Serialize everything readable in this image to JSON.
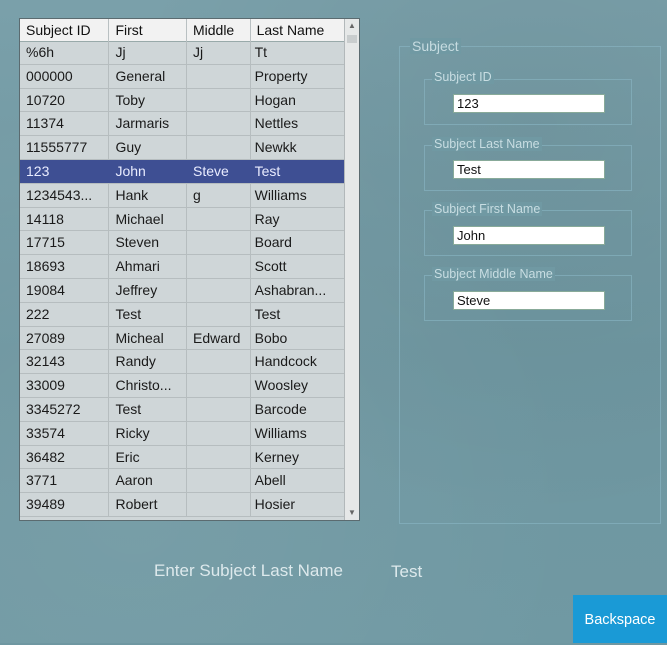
{
  "grid": {
    "columns": [
      "Subject ID",
      "First",
      "Middle",
      "Last Name"
    ],
    "rows": [
      [
        "%6h",
        "Jj",
        "Jj",
        "Tt"
      ],
      [
        "000000",
        "General",
        "",
        "Property"
      ],
      [
        "10720",
        "Toby",
        "",
        "Hogan"
      ],
      [
        "11374",
        "Jarmaris",
        "",
        "Nettles"
      ],
      [
        "11555777",
        "Guy",
        "",
        "Newkk"
      ],
      [
        "123",
        "John",
        "Steve",
        "Test"
      ],
      [
        "1234543...",
        "Hank",
        "g",
        "Williams"
      ],
      [
        "14118",
        "Michael",
        "",
        "Ray"
      ],
      [
        "17715",
        "Steven",
        "",
        "Board"
      ],
      [
        "18693",
        "Ahmari",
        "",
        "Scott"
      ],
      [
        "19084",
        "Jeffrey",
        "",
        "Ashabran..."
      ],
      [
        "222",
        "Test",
        "",
        "Test"
      ],
      [
        "27089",
        "Micheal",
        "Edward",
        "Bobo"
      ],
      [
        "32143",
        "Randy",
        "",
        "Handcock"
      ],
      [
        "33009",
        "Christo...",
        "",
        "Woosley"
      ],
      [
        "3345272",
        "Test",
        "",
        "Barcode"
      ],
      [
        "33574",
        "Ricky",
        "",
        "Williams"
      ],
      [
        "36482",
        "Eric",
        "",
        "Kerney"
      ],
      [
        "3771",
        "Aaron",
        "",
        "Abell"
      ],
      [
        "39489",
        "Robert",
        "",
        "Hosier"
      ]
    ],
    "selected_index": 5
  },
  "subject": {
    "title": "Subject",
    "id_label": "Subject ID",
    "id_value": "123",
    "last_label": "Subject Last Name",
    "last_value": "Test",
    "first_label": "Subject First Name",
    "first_value": "John",
    "middle_label": "Subject Middle Name",
    "middle_value": "Steve"
  },
  "prompt": {
    "label": "Enter Subject Last Name",
    "value": "Test"
  },
  "backspace_label": "Backspace",
  "colors": {
    "background": "#7099a3",
    "selection": "#3e4f93",
    "button": "#1a9ad6"
  }
}
